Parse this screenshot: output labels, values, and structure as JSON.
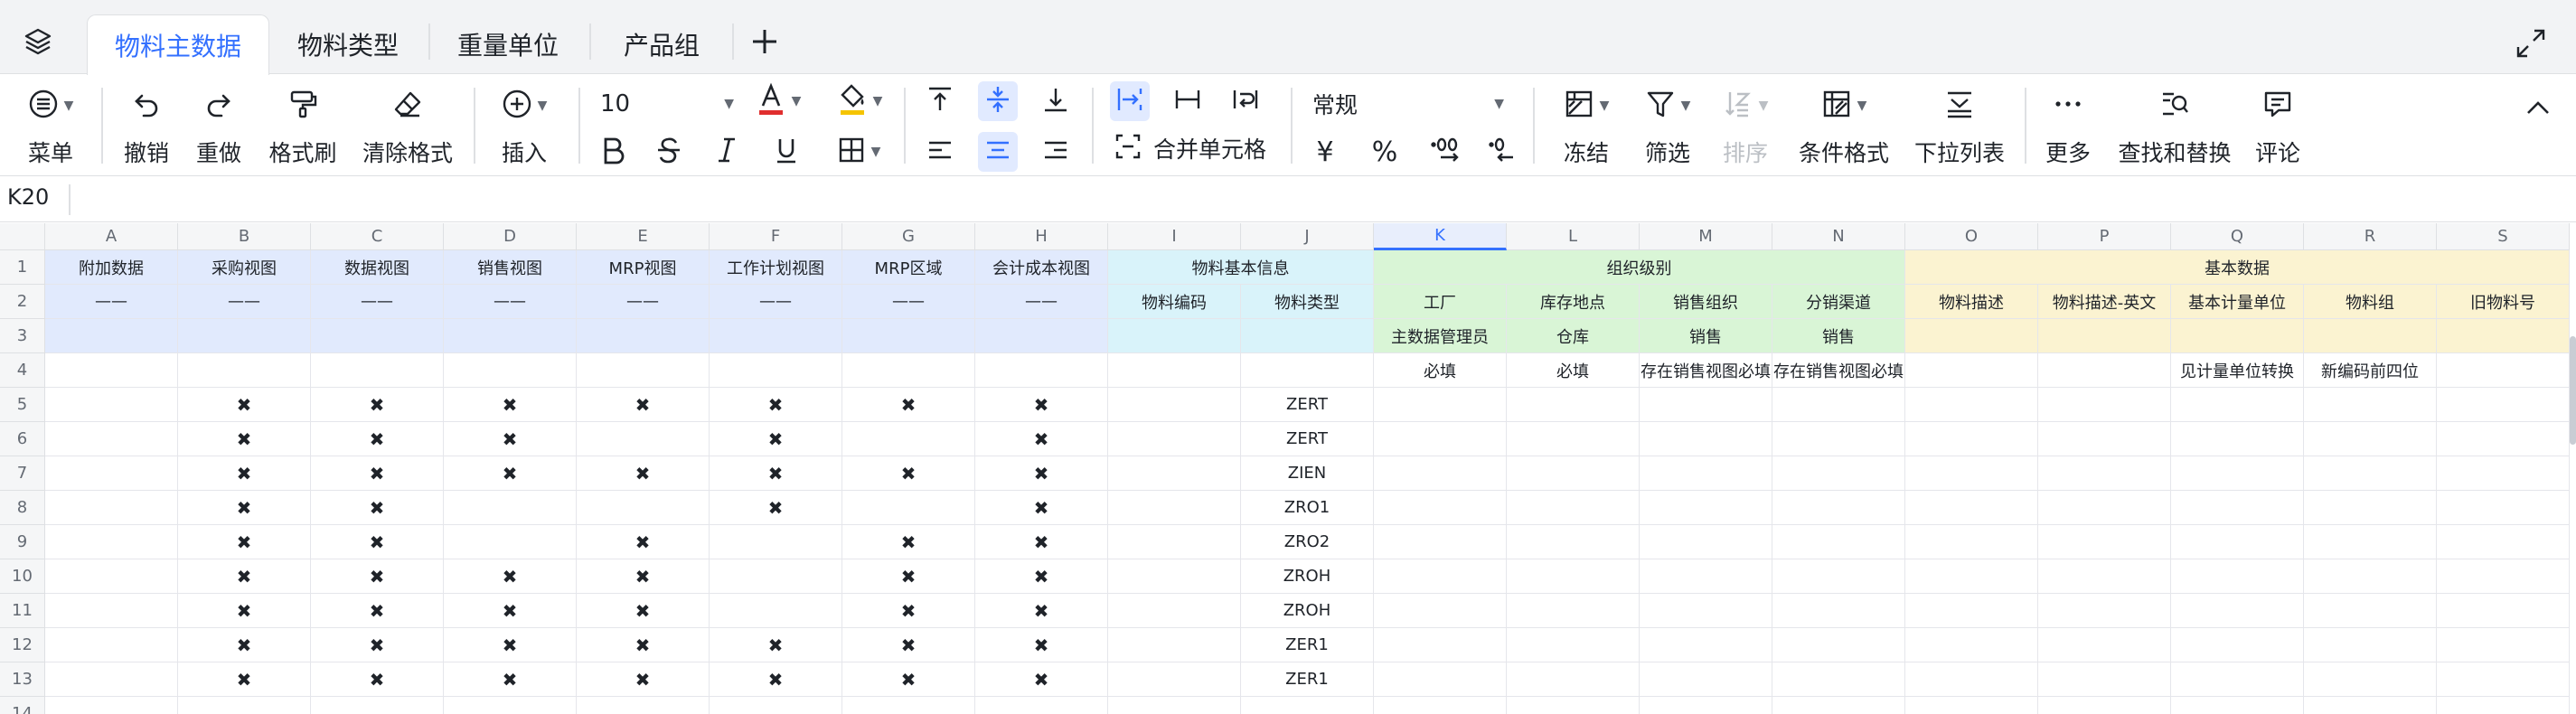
{
  "tabs": [
    {
      "label": "物料主数据",
      "active": true
    },
    {
      "label": "物料类型",
      "active": false
    },
    {
      "label": "重量单位",
      "active": false
    },
    {
      "label": "产品组",
      "active": false
    }
  ],
  "toolbar": {
    "menu": "菜单",
    "undo": "撤销",
    "redo": "重做",
    "format_painter": "格式刷",
    "clear_format": "清除格式",
    "insert": "插入",
    "font_size": "10",
    "merge_cells": "合并单元格",
    "number_format": "常规",
    "currency_symbol": "¥",
    "percent_symbol": "%",
    "freeze": "冻结",
    "filter": "筛选",
    "sort": "排序",
    "conditional_format": "条件格式",
    "dropdown_list": "下拉列表",
    "more": "更多",
    "find_replace": "查找和替换",
    "comment": "评论",
    "accent": "#3370ff"
  },
  "formula_bar": {
    "cell_ref": "K20"
  },
  "grid": {
    "columns": [
      "A",
      "B",
      "C",
      "D",
      "E",
      "F",
      "G",
      "H",
      "I",
      "J",
      "K",
      "L",
      "M",
      "N",
      "O",
      "P",
      "Q",
      "R",
      "S"
    ],
    "row_numbers": [
      "1",
      "2",
      "3",
      "4",
      "5",
      "6",
      "7",
      "8",
      "9",
      "10",
      "11",
      "12",
      "13",
      "14"
    ],
    "group_headers": {
      "basic_info": "物料基本信息",
      "org_level": "组织级别",
      "basic_data": "基本数据"
    },
    "row1": [
      "附加数据",
      "采购视图",
      "数据视图",
      "销售视图",
      "MRP视图",
      "工作计划视图",
      "MRP区域",
      "会计成本视图"
    ],
    "row2_dashes": [
      "——",
      "——",
      "——",
      "——",
      "——",
      "——",
      "——",
      "——"
    ],
    "row2_fields": [
      "物料编码",
      "物料类型",
      "工厂",
      "库存地点",
      "销售组织",
      "分销渠道",
      "物料描述",
      "物料描述-英文",
      "基本计量单位",
      "物料组",
      "旧物料号"
    ],
    "row3": {
      "K": "主数据管理员",
      "L": "仓库",
      "M": "销售",
      "N": "销售"
    },
    "row4": {
      "K": "必填",
      "L": "必填",
      "M": "存在销售视图必填",
      "N": "存在销售视图必填",
      "Q": "见计量单位转换",
      "R": "新编码前四位"
    },
    "mark": "✖",
    "data_rows": [
      {
        "marks": [
          "B",
          "C",
          "D",
          "E",
          "F",
          "G",
          "H"
        ],
        "J": "ZERT"
      },
      {
        "marks": [
          "B",
          "C",
          "D",
          "F",
          "H"
        ],
        "J": "ZERT"
      },
      {
        "marks": [
          "B",
          "C",
          "D",
          "E",
          "F",
          "G",
          "H"
        ],
        "J": "ZIEN"
      },
      {
        "marks": [
          "B",
          "C",
          "F",
          "H"
        ],
        "J": "ZRO1"
      },
      {
        "marks": [
          "B",
          "C",
          "E",
          "G",
          "H"
        ],
        "J": "ZRO2"
      },
      {
        "marks": [
          "B",
          "C",
          "D",
          "E",
          "G",
          "H"
        ],
        "J": "ZROH"
      },
      {
        "marks": [
          "B",
          "C",
          "D",
          "E",
          "G",
          "H"
        ],
        "J": "ZROH"
      },
      {
        "marks": [
          "B",
          "C",
          "D",
          "E",
          "F",
          "G",
          "H"
        ],
        "J": "ZER1"
      },
      {
        "marks": [
          "B",
          "C",
          "D",
          "E",
          "F",
          "G",
          "H"
        ],
        "J": "ZER1"
      }
    ],
    "colors": {
      "blue_section": "#e1eafd",
      "cyan_section": "#d9f3fa",
      "green_section": "#d9f5d6",
      "yellow_section": "#fbf3d1"
    }
  }
}
